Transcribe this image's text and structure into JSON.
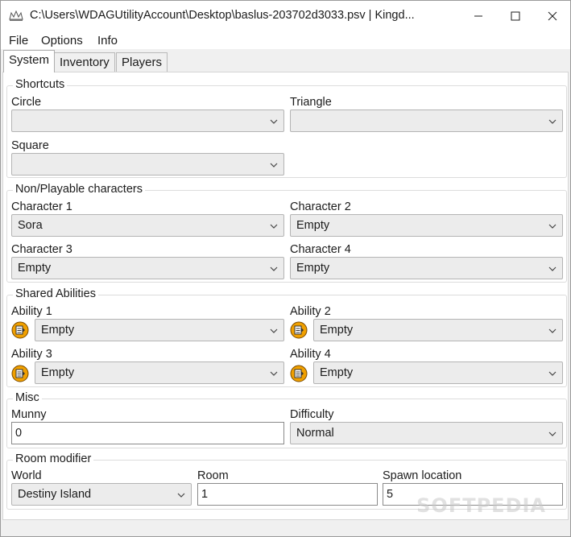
{
  "window": {
    "title": "C:\\Users\\WDAGUtilityAccount\\Desktop\\baslus-203702d3033.psv | Kingd..."
  },
  "menu": [
    "File",
    "Options",
    "Info"
  ],
  "tabs": [
    "System",
    "Inventory",
    "Players"
  ],
  "shortcuts": {
    "title": "Shortcuts",
    "circle": {
      "label": "Circle",
      "value": ""
    },
    "triangle": {
      "label": "Triangle",
      "value": ""
    },
    "square": {
      "label": "Square",
      "value": ""
    }
  },
  "characters": {
    "title": "Non/Playable characters",
    "c1": {
      "label": "Character 1",
      "value": "Sora"
    },
    "c2": {
      "label": "Character 2",
      "value": "Empty"
    },
    "c3": {
      "label": "Character 3",
      "value": "Empty"
    },
    "c4": {
      "label": "Character 4",
      "value": "Empty"
    }
  },
  "abilities": {
    "title": "Shared Abilities",
    "a1": {
      "label": "Ability 1",
      "value": "Empty"
    },
    "a2": {
      "label": "Ability 2",
      "value": "Empty"
    },
    "a3": {
      "label": "Ability 3",
      "value": "Empty"
    },
    "a4": {
      "label": "Ability 4",
      "value": "Empty"
    }
  },
  "misc": {
    "title": "Misc",
    "munny": {
      "label": "Munny",
      "value": "0"
    },
    "difficulty": {
      "label": "Difficulty",
      "value": "Normal"
    }
  },
  "room": {
    "title": "Room modifier",
    "world": {
      "label": "World",
      "value": "Destiny Island"
    },
    "room": {
      "label": "Room",
      "value": "1"
    },
    "spawn": {
      "label": "Spawn location",
      "value": "5"
    }
  },
  "watermark": "SOFTPEDIA",
  "colors": {
    "accent": "#f0a000",
    "panel": "#ffffff",
    "chrome": "#f0f0f0"
  }
}
